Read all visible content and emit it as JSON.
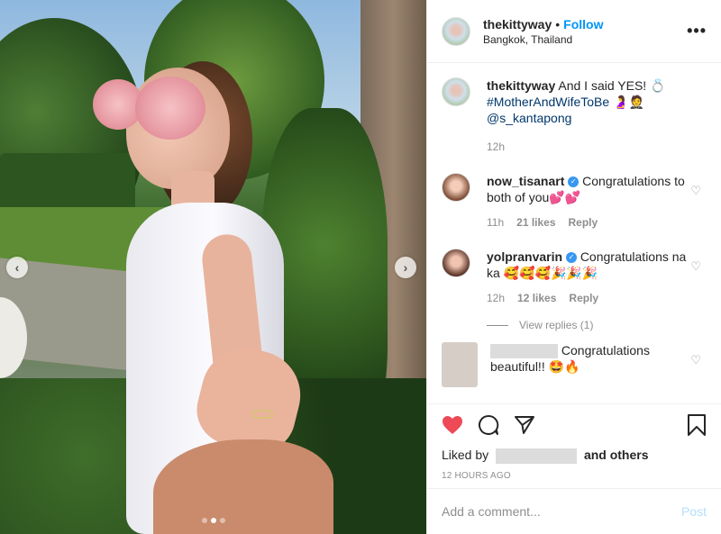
{
  "photo": {
    "slide_count": 3,
    "active_slide": 2
  },
  "header": {
    "username": "thekittyway",
    "separator": "•",
    "follow_label": "Follow",
    "location": "Bangkok, Thailand",
    "more_icon": "•••"
  },
  "caption": {
    "username": "thekittyway",
    "text_line1": "And I said YES! 💍",
    "hashtag": "#MotherAndWifeToBe",
    "emoji_after_hashtag": "🤰🤵",
    "mention": "@s_kantapong",
    "age": "12h"
  },
  "comments": [
    {
      "username": "now_tisanart",
      "verified_icon": "✓",
      "text": "Congratulations to both of you💕💕",
      "age": "11h",
      "likes": "21 likes",
      "reply": "Reply"
    },
    {
      "username": "yolpranvarin",
      "verified_icon": "✓",
      "text": "Congratulations na ka 🥰🥰🥰🎉🎉🎉",
      "age": "12h",
      "likes": "12 likes",
      "reply": "Reply"
    }
  ],
  "view_replies": "View replies (1)",
  "comment3": {
    "text_suffix": "Congratulations",
    "text_line2": "beautiful!! 🤩🔥"
  },
  "liked_by": {
    "prefix": "Liked by",
    "suffix": "and others"
  },
  "timestamp": "12 HOURS AGO",
  "add_comment": {
    "placeholder": "Add a comment...",
    "post_label": "Post"
  },
  "colors": {
    "like_active": "#ed4956",
    "link": "#0095f6",
    "hashtag": "#00376b"
  }
}
